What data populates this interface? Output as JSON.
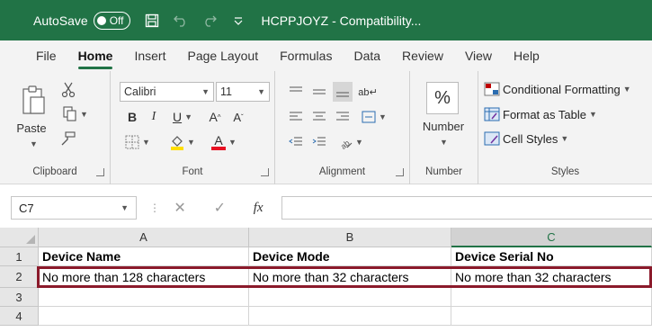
{
  "colors": {
    "accent": "#217346",
    "highlight_border": "#8b1a2b",
    "font_color_red": "#e81123",
    "fill_yellow": "#ffde00"
  },
  "titlebar": {
    "autosave_label": "AutoSave",
    "autosave_state": "Off",
    "doc_title": "HCPPJOYZ - Compatibility...",
    "icons": [
      "save-icon",
      "undo-icon",
      "redo-icon",
      "customize-qat-icon"
    ]
  },
  "tabs": [
    {
      "label": "File"
    },
    {
      "label": "Home",
      "active": true
    },
    {
      "label": "Insert"
    },
    {
      "label": "Page Layout"
    },
    {
      "label": "Formulas"
    },
    {
      "label": "Data"
    },
    {
      "label": "Review"
    },
    {
      "label": "View"
    },
    {
      "label": "Help"
    }
  ],
  "ribbon": {
    "clipboard": {
      "label": "Clipboard",
      "paste": "Paste"
    },
    "font": {
      "label": "Font",
      "name": "Calibri",
      "size": "11"
    },
    "alignment": {
      "label": "Alignment"
    },
    "number": {
      "label": "Number",
      "button": "Number",
      "icon_text": "%"
    },
    "styles": {
      "label": "Styles",
      "conditional": "Conditional Formatting",
      "format_table": "Format as Table",
      "cell_styles": "Cell Styles"
    }
  },
  "formula_bar": {
    "name_box": "C7",
    "fx": "fx",
    "value": ""
  },
  "grid": {
    "columns": [
      "A",
      "B",
      "C"
    ],
    "selected_column": "C",
    "rows": [
      {
        "num": "1",
        "cells": [
          "Device Name",
          "Device Mode",
          "Device Serial No"
        ]
      },
      {
        "num": "2",
        "cells": [
          "No more than 128 characters",
          "No more than 32 characters",
          "No more than 32 characters"
        ]
      },
      {
        "num": "3",
        "cells": [
          "",
          "",
          ""
        ]
      },
      {
        "num": "4",
        "cells": [
          "",
          "",
          ""
        ]
      }
    ]
  }
}
